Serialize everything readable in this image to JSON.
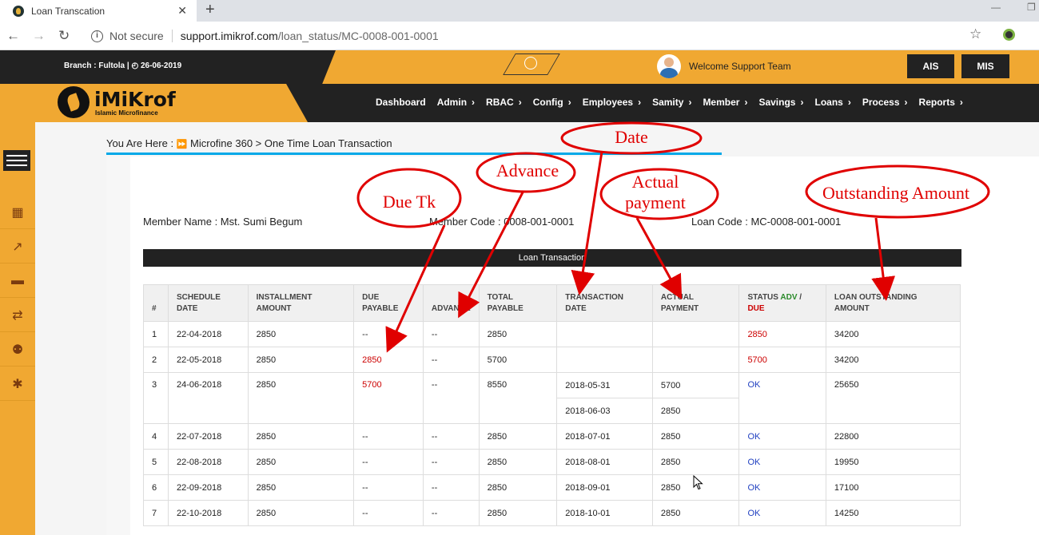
{
  "browser": {
    "tab_title": "Loan Transcation",
    "tab_close": "✕",
    "new_tab": "+",
    "not_secure": "Not secure",
    "url_host": "support.imikrof.com",
    "url_path": "/loan_status/MC-0008-001-0001",
    "info_glyph": "i",
    "back_glyph": "←",
    "forward_glyph": "→",
    "reload_glyph": "↻",
    "star_glyph": "☆",
    "min_glyph": "—",
    "max_glyph": "❐"
  },
  "header": {
    "branch": "Branch : Fultola |  ◴ 26-06-2019",
    "welcome": "Welcome Support Team",
    "ais_label": "AIS",
    "mis_label": "MIS",
    "logo_text": "iMiKrof",
    "logo_sub": "Islamic Microfinance"
  },
  "nav": {
    "items": [
      {
        "label": "Dashboard",
        "chev": ""
      },
      {
        "label": "Admin",
        "chev": "›"
      },
      {
        "label": "RBAC",
        "chev": "›"
      },
      {
        "label": "Config",
        "chev": "›"
      },
      {
        "label": "Employees",
        "chev": "›"
      },
      {
        "label": "Samity",
        "chev": "›"
      },
      {
        "label": "Member",
        "chev": "›"
      },
      {
        "label": "Savings",
        "chev": "›"
      },
      {
        "label": "Loans",
        "chev": "›"
      },
      {
        "label": "Process",
        "chev": "›"
      },
      {
        "label": "Reports",
        "chev": "›"
      }
    ]
  },
  "sidebar": {
    "icons": [
      "building-icon",
      "chart-icon",
      "bus-icon",
      "transfer-icon",
      "users-icon",
      "settings-icon"
    ],
    "glyphs": [
      "▦",
      "↗",
      "▬",
      "⇄",
      "⚉",
      "✱"
    ]
  },
  "breadcrumb": {
    "prefix": "You Are Here   :",
    "arrows": "⏩",
    "path": "Microfine 360 > One Time Loan Transaction"
  },
  "member": {
    "name": "Member Name : Mst. Sumi Begum",
    "code": "Member Code : 0008-001-0001",
    "loan_code": "Loan Code : MC-0008-001-0001"
  },
  "table": {
    "title": "Loan Transaction",
    "headers": {
      "num": "#",
      "schedule_date": "SCHEDULE DATE",
      "installment_amount": "INSTALLMENT AMOUNT",
      "due_payable": "DUE PAYABLE",
      "advance": "ADVANCE",
      "total_payable": "TOTAL PAYABLE",
      "transaction_date": "TRANSACTION DATE",
      "actual_payment": "ACTUAL PAYMENT",
      "status_prefix": "STATUS",
      "status_adv": "ADV",
      "status_sep": "/",
      "status_due": "DUE",
      "loan_outstanding": "LOAN OUTSTANDING AMOUNT"
    },
    "rows": [
      {
        "num": "1",
        "schedule": "22-04-2018",
        "installment": "2850",
        "due": "--",
        "advance": "--",
        "total": "2850",
        "tx": [],
        "status": "2850",
        "outstanding": "34200"
      },
      {
        "num": "2",
        "schedule": "22-05-2018",
        "installment": "2850",
        "due": "2850",
        "advance": "--",
        "total": "5700",
        "tx": [],
        "status": "5700",
        "outstanding": "34200"
      },
      {
        "num": "3",
        "schedule": "24-06-2018",
        "installment": "2850",
        "due": "5700",
        "advance": "--",
        "total": "8550",
        "tx": [
          {
            "date": "2018-05-31",
            "amount": "5700"
          },
          {
            "date": "2018-06-03",
            "amount": "2850"
          }
        ],
        "status": "OK",
        "outstanding": "25650"
      },
      {
        "num": "4",
        "schedule": "22-07-2018",
        "installment": "2850",
        "due": "--",
        "advance": "--",
        "total": "2850",
        "tx": [
          {
            "date": "2018-07-01",
            "amount": "2850"
          }
        ],
        "status": "OK",
        "outstanding": "22800"
      },
      {
        "num": "5",
        "schedule": "22-08-2018",
        "installment": "2850",
        "due": "--",
        "advance": "--",
        "total": "2850",
        "tx": [
          {
            "date": "2018-08-01",
            "amount": "2850"
          }
        ],
        "status": "OK",
        "outstanding": "19950"
      },
      {
        "num": "6",
        "schedule": "22-09-2018",
        "installment": "2850",
        "due": "--",
        "advance": "--",
        "total": "2850",
        "tx": [
          {
            "date": "2018-09-01",
            "amount": "2850"
          }
        ],
        "status": "OK",
        "outstanding": "17100"
      },
      {
        "num": "7",
        "schedule": "22-10-2018",
        "installment": "2850",
        "due": "--",
        "advance": "--",
        "total": "2850",
        "tx": [
          {
            "date": "2018-10-01",
            "amount": "2850"
          }
        ],
        "status": "OK",
        "outstanding": "14250"
      }
    ]
  },
  "annotations": {
    "date": "Date",
    "advance": "Advance",
    "due_tk": "Due Tk",
    "actual_payment_1": "Actual",
    "actual_payment_2": "payment",
    "outstanding": "Outstanding Amount"
  },
  "colors": {
    "brand_orange": "#f0a832",
    "dark": "#222222",
    "accent_blue": "#00a8e8",
    "due_red": "#cc0000",
    "ok_blue": "#1f3fc0",
    "annotation_red": "#e00000"
  }
}
